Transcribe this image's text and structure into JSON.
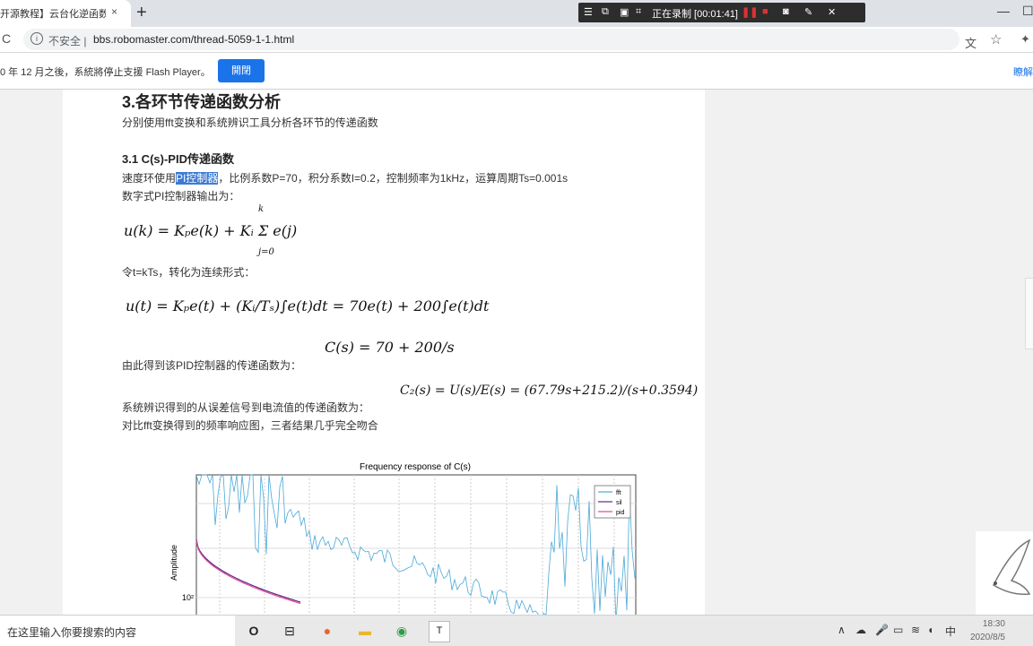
{
  "browser": {
    "tab_title": "开源教程】云台化逆函数 -",
    "tab_close": "×",
    "new_tab": "+",
    "recording_label": "正在录制 [00:01:41]",
    "win_min": "—",
    "win_max": "☐",
    "win_close": "✕",
    "reload": "C",
    "insecure_label": "不安全 |",
    "url": "bbs.robomaster.com/thread-5059-1-1.html"
  },
  "infobar": {
    "text": "0 年 12 月之後，系統將停止支援 Flash Player。",
    "button_label": "開閉",
    "more_label": "瞭解"
  },
  "article": {
    "heading": "3.各环节传递函数分析",
    "intro": "分别使用fft变换和系统辨识工具分析各环节的传递函数",
    "subheading": "3.1 C(s)-PID传递函数",
    "line1_prefix": "速度环使用",
    "line1_highlight": "PI控制器",
    "line1_suffix": "，比例系数P=70，积分系数I=0.2，控制频率为1kHz，运算周期Ts=0.001s",
    "line2": "数字式PI控制器输出为：",
    "eq1": "u(k) = Kₚe(k) + Kᵢ Σ e(j)",
    "line3": "令t=kTs，转化为连续形式：",
    "eq2": "u(t) = Kₚe(t) + (Kᵢ/Tₛ)∫e(t)dt = 70e(t) + 200∫e(t)dt",
    "eq3": "C(s) = 70 + 200/s",
    "line4": "由此得到该PID控制器的传递函数为：",
    "eq4": "C₂(s) = U(s)/E(s) = (67.79s+215.2)/(s+0.3594)",
    "line5": "系统辨识得到的从误差信号到电流值的传递函数为：",
    "line6": "对比fft变换得到的频率响应图，三者结果几乎完全吻合"
  },
  "chart_data": {
    "type": "line",
    "title": "Frequency response of C(s)",
    "ylabel": "Amplitude",
    "xlabel": "",
    "yscale": "log",
    "ytick_visible": "10²",
    "legend": [
      "fft",
      "sil",
      "pid"
    ],
    "legend_position": "top-right",
    "grid": true,
    "series": [
      {
        "name": "fft",
        "color": "#4aa8d8"
      },
      {
        "name": "sil",
        "color": "#5b2a86"
      },
      {
        "name": "pid",
        "color": "#e0469a"
      }
    ]
  },
  "taskbar": {
    "search_placeholder": "在这里输入你要搜索的内容",
    "ime": "中",
    "time": "18:30",
    "date": "2020/8/5"
  }
}
